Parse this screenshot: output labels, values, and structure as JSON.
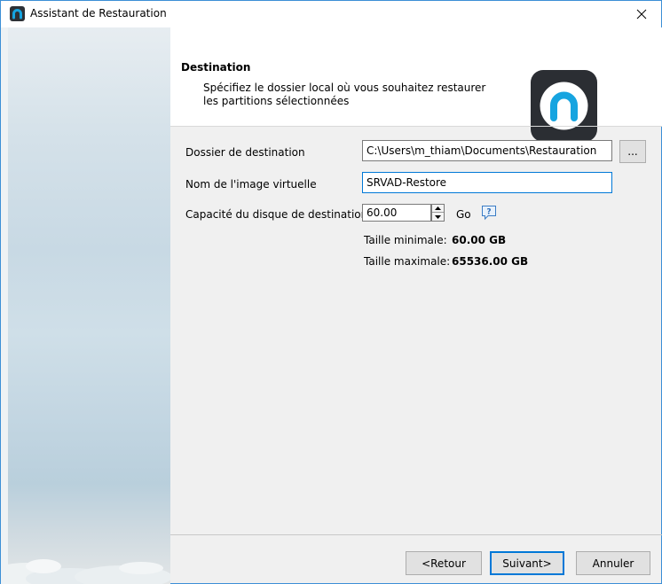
{
  "window": {
    "title": "Assistant de Restauration",
    "close_glyph": "✕"
  },
  "header": {
    "title": "Destination",
    "description": "Spécifiez le dossier local où vous souhaitez restaurer les partitions sélectionnées"
  },
  "form": {
    "destination_label": "Dossier de destination",
    "destination_value": "C:\\Users\\m_thiam\\Documents\\Restauration",
    "browse_label": "...",
    "image_name_label": "Nom de l'image virtuelle",
    "image_name_value": "SRVAD-Restore",
    "capacity_label": "Capacité du disque de destination",
    "capacity_value": "60.00",
    "capacity_unit": "Go",
    "min_size_label": "Taille minimale:",
    "min_size_value": "60.00 GB",
    "max_size_label": "Taille maximale:",
    "max_size_value": "65536.00 GB"
  },
  "buttons": {
    "back": "<Retour",
    "next": "Suivant>",
    "cancel": "Annuler"
  },
  "icons": {
    "app": "app-logo-icon",
    "close": "close-icon",
    "help": "help-icon",
    "spin_up": "arrow-up-icon",
    "spin_down": "arrow-down-icon"
  },
  "colors": {
    "accent": "#0078d7",
    "logo_bg": "#2b2e33",
    "logo_arc": "#16a4e0"
  }
}
